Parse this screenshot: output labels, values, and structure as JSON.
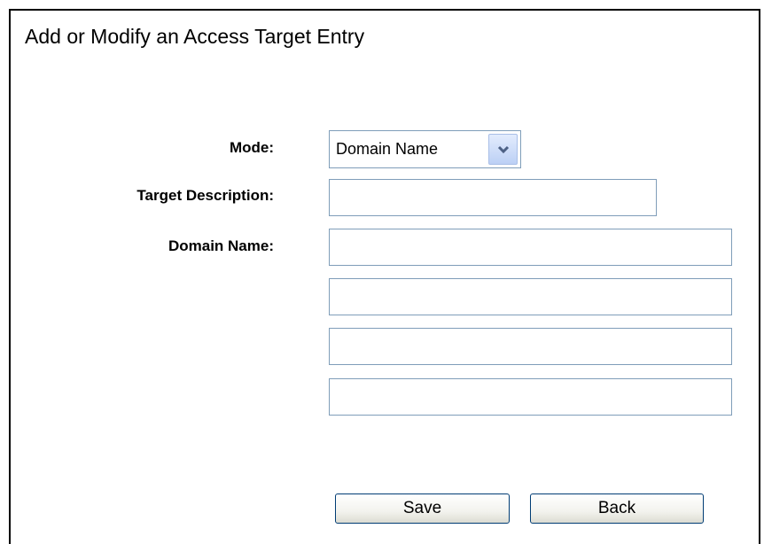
{
  "page": {
    "title": "Add or Modify an Access Target Entry"
  },
  "form": {
    "mode_label": "Mode:",
    "mode_value": "Domain Name",
    "target_description_label": "Target Description:",
    "target_description_value": "",
    "domain_name_label": "Domain Name:",
    "domain_names": [
      "",
      "",
      "",
      ""
    ]
  },
  "buttons": {
    "save": "Save",
    "back": "Back"
  },
  "icons": {
    "dropdown": "chevron-down-icon"
  }
}
